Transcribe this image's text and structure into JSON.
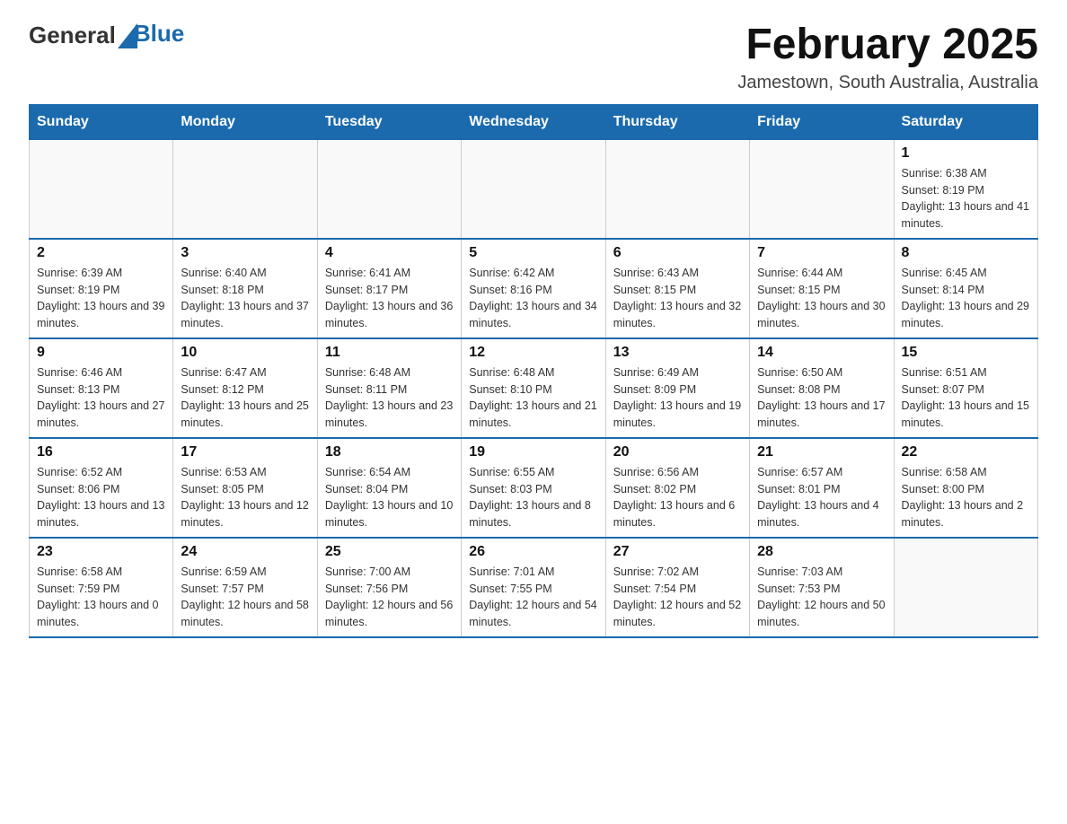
{
  "header": {
    "logo_general": "General",
    "logo_blue": "Blue",
    "title": "February 2025",
    "subtitle": "Jamestown, South Australia, Australia"
  },
  "days_of_week": [
    "Sunday",
    "Monday",
    "Tuesday",
    "Wednesday",
    "Thursday",
    "Friday",
    "Saturday"
  ],
  "weeks": [
    [
      {
        "day": "",
        "info": ""
      },
      {
        "day": "",
        "info": ""
      },
      {
        "day": "",
        "info": ""
      },
      {
        "day": "",
        "info": ""
      },
      {
        "day": "",
        "info": ""
      },
      {
        "day": "",
        "info": ""
      },
      {
        "day": "1",
        "info": "Sunrise: 6:38 AM\nSunset: 8:19 PM\nDaylight: 13 hours and 41 minutes."
      }
    ],
    [
      {
        "day": "2",
        "info": "Sunrise: 6:39 AM\nSunset: 8:19 PM\nDaylight: 13 hours and 39 minutes."
      },
      {
        "day": "3",
        "info": "Sunrise: 6:40 AM\nSunset: 8:18 PM\nDaylight: 13 hours and 37 minutes."
      },
      {
        "day": "4",
        "info": "Sunrise: 6:41 AM\nSunset: 8:17 PM\nDaylight: 13 hours and 36 minutes."
      },
      {
        "day": "5",
        "info": "Sunrise: 6:42 AM\nSunset: 8:16 PM\nDaylight: 13 hours and 34 minutes."
      },
      {
        "day": "6",
        "info": "Sunrise: 6:43 AM\nSunset: 8:15 PM\nDaylight: 13 hours and 32 minutes."
      },
      {
        "day": "7",
        "info": "Sunrise: 6:44 AM\nSunset: 8:15 PM\nDaylight: 13 hours and 30 minutes."
      },
      {
        "day": "8",
        "info": "Sunrise: 6:45 AM\nSunset: 8:14 PM\nDaylight: 13 hours and 29 minutes."
      }
    ],
    [
      {
        "day": "9",
        "info": "Sunrise: 6:46 AM\nSunset: 8:13 PM\nDaylight: 13 hours and 27 minutes."
      },
      {
        "day": "10",
        "info": "Sunrise: 6:47 AM\nSunset: 8:12 PM\nDaylight: 13 hours and 25 minutes."
      },
      {
        "day": "11",
        "info": "Sunrise: 6:48 AM\nSunset: 8:11 PM\nDaylight: 13 hours and 23 minutes."
      },
      {
        "day": "12",
        "info": "Sunrise: 6:48 AM\nSunset: 8:10 PM\nDaylight: 13 hours and 21 minutes."
      },
      {
        "day": "13",
        "info": "Sunrise: 6:49 AM\nSunset: 8:09 PM\nDaylight: 13 hours and 19 minutes."
      },
      {
        "day": "14",
        "info": "Sunrise: 6:50 AM\nSunset: 8:08 PM\nDaylight: 13 hours and 17 minutes."
      },
      {
        "day": "15",
        "info": "Sunrise: 6:51 AM\nSunset: 8:07 PM\nDaylight: 13 hours and 15 minutes."
      }
    ],
    [
      {
        "day": "16",
        "info": "Sunrise: 6:52 AM\nSunset: 8:06 PM\nDaylight: 13 hours and 13 minutes."
      },
      {
        "day": "17",
        "info": "Sunrise: 6:53 AM\nSunset: 8:05 PM\nDaylight: 13 hours and 12 minutes."
      },
      {
        "day": "18",
        "info": "Sunrise: 6:54 AM\nSunset: 8:04 PM\nDaylight: 13 hours and 10 minutes."
      },
      {
        "day": "19",
        "info": "Sunrise: 6:55 AM\nSunset: 8:03 PM\nDaylight: 13 hours and 8 minutes."
      },
      {
        "day": "20",
        "info": "Sunrise: 6:56 AM\nSunset: 8:02 PM\nDaylight: 13 hours and 6 minutes."
      },
      {
        "day": "21",
        "info": "Sunrise: 6:57 AM\nSunset: 8:01 PM\nDaylight: 13 hours and 4 minutes."
      },
      {
        "day": "22",
        "info": "Sunrise: 6:58 AM\nSunset: 8:00 PM\nDaylight: 13 hours and 2 minutes."
      }
    ],
    [
      {
        "day": "23",
        "info": "Sunrise: 6:58 AM\nSunset: 7:59 PM\nDaylight: 13 hours and 0 minutes."
      },
      {
        "day": "24",
        "info": "Sunrise: 6:59 AM\nSunset: 7:57 PM\nDaylight: 12 hours and 58 minutes."
      },
      {
        "day": "25",
        "info": "Sunrise: 7:00 AM\nSunset: 7:56 PM\nDaylight: 12 hours and 56 minutes."
      },
      {
        "day": "26",
        "info": "Sunrise: 7:01 AM\nSunset: 7:55 PM\nDaylight: 12 hours and 54 minutes."
      },
      {
        "day": "27",
        "info": "Sunrise: 7:02 AM\nSunset: 7:54 PM\nDaylight: 12 hours and 52 minutes."
      },
      {
        "day": "28",
        "info": "Sunrise: 7:03 AM\nSunset: 7:53 PM\nDaylight: 12 hours and 50 minutes."
      },
      {
        "day": "",
        "info": ""
      }
    ]
  ]
}
